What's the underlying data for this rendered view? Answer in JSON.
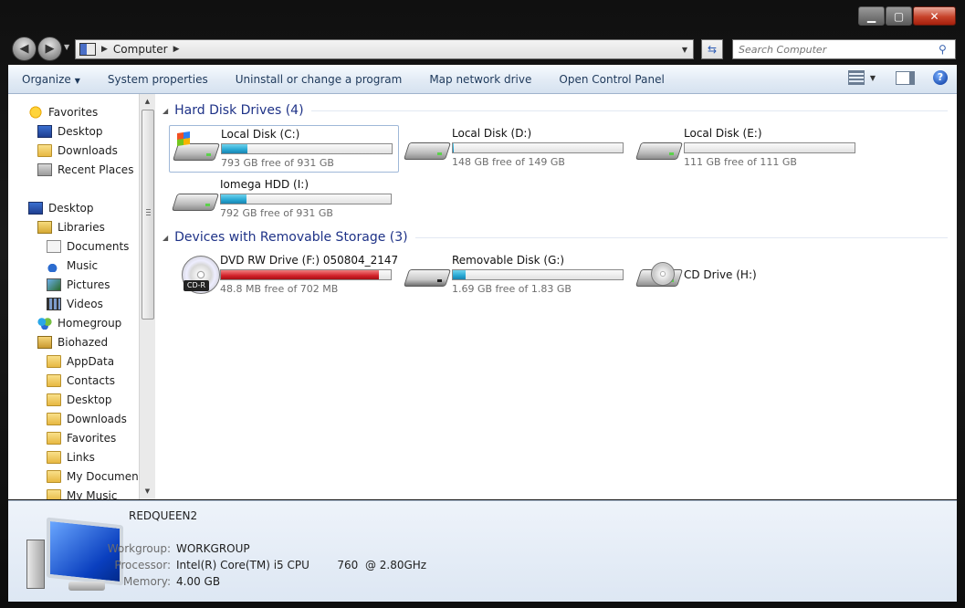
{
  "window": {
    "caption": {
      "minimize": "▁",
      "maximize": "▢",
      "close": "✕"
    }
  },
  "nav": {
    "back": "◀",
    "forward": "▶",
    "address": {
      "segments": [
        "Computer"
      ]
    },
    "search": {
      "placeholder": "Search Computer"
    }
  },
  "toolbar": {
    "items": [
      {
        "label": "Organize",
        "has_menu": true
      },
      {
        "label": "System properties"
      },
      {
        "label": "Uninstall or change a program"
      },
      {
        "label": "Map network drive"
      },
      {
        "label": "Open Control Panel"
      }
    ],
    "help": "?"
  },
  "navpane": {
    "items": [
      {
        "label": "Favorites",
        "icon": "star-icon"
      },
      {
        "label": "Desktop",
        "icon": "desktop-icon"
      },
      {
        "label": "Downloads",
        "icon": "folder-icon"
      },
      {
        "label": "Recent Places",
        "icon": "recent-places-icon"
      },
      {
        "label": "Desktop",
        "icon": "desktop-icon"
      },
      {
        "label": "Libraries",
        "icon": "libraries-icon"
      },
      {
        "label": "Documents",
        "icon": "documents-icon"
      },
      {
        "label": "Music",
        "icon": "music-icon"
      },
      {
        "label": "Pictures",
        "icon": "pictures-icon"
      },
      {
        "label": "Videos",
        "icon": "videos-icon"
      },
      {
        "label": "Homegroup",
        "icon": "homegroup-icon"
      },
      {
        "label": "Biohazed",
        "icon": "user-folder-icon"
      },
      {
        "label": "AppData",
        "icon": "folder-icon"
      },
      {
        "label": "Contacts",
        "icon": "folder-icon"
      },
      {
        "label": "Desktop",
        "icon": "folder-icon"
      },
      {
        "label": "Downloads",
        "icon": "folder-icon"
      },
      {
        "label": "Favorites",
        "icon": "folder-icon"
      },
      {
        "label": "Links",
        "icon": "folder-icon"
      },
      {
        "label": "My Documents",
        "icon": "folder-icon"
      },
      {
        "label": "My Music",
        "icon": "folder-icon"
      }
    ]
  },
  "groups": [
    {
      "label": "Hard Disk Drives (4)"
    },
    {
      "label": "Devices with Removable Storage (3)"
    }
  ],
  "drives": [
    {
      "name": "Local Disk (C:)",
      "free": "793 GB free of 931 GB",
      "used_fraction": 0.148,
      "icon": "system-drive-icon"
    },
    {
      "name": "Local Disk (D:)",
      "free": "148 GB free of 149 GB",
      "used_fraction": 0.007,
      "icon": "hard-drive-icon"
    },
    {
      "name": "Local Disk (E:)",
      "free": "111 GB free of 111 GB",
      "used_fraction": 0.0,
      "icon": "hard-drive-icon"
    },
    {
      "name": "Iomega HDD (I:)",
      "free": "792 GB free of 931 GB",
      "used_fraction": 0.149,
      "icon": "hard-drive-icon"
    },
    {
      "name": "DVD RW Drive (F:) 050804_2147",
      "free": "48.8 MB free of 702 MB",
      "used_fraction": 0.93,
      "icon": "dvd-drive-icon",
      "badge": "CD-R",
      "bar_color": "#d3212a"
    },
    {
      "name": "Removable Disk (G:)",
      "free": "1.69 GB free of 1.83 GB",
      "used_fraction": 0.077,
      "icon": "removable-disk-icon"
    },
    {
      "name": "CD Drive (H:)",
      "icon": "cd-drive-icon"
    }
  ],
  "details": {
    "computer_name": "REDQUEEN2",
    "rows": [
      {
        "label": "Workgroup:",
        "value": "WORKGROUP"
      },
      {
        "label": "Processor:",
        "value": "Intel(R) Core(TM) i5 CPU        760  @ 2.80GHz"
      },
      {
        "label": "Memory:",
        "value": "4.00 GB"
      }
    ]
  }
}
